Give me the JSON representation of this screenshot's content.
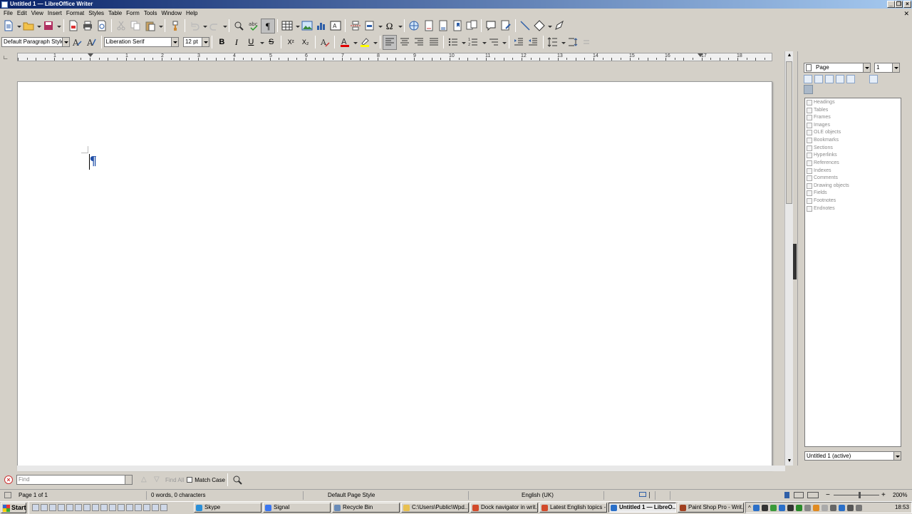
{
  "window": {
    "title": "Untitled 1 — LibreOffice Writer",
    "minimize": "_",
    "restore": "❐",
    "close": "×"
  },
  "menubar": {
    "items": [
      "File",
      "Edit",
      "View",
      "Insert",
      "Format",
      "Styles",
      "Table",
      "Form",
      "Tools",
      "Window",
      "Help"
    ],
    "doc_close": "✕"
  },
  "formatting": {
    "paragraph_style": "Default Paragraph Style",
    "font_name": "Liberation Serif",
    "font_size": "12 pt",
    "bold": "B",
    "italic": "I",
    "underline": "U",
    "strike": "S",
    "superscript": "X²",
    "subscript": "X₂"
  },
  "ruler": {
    "numbers": [
      "1",
      "1",
      "2",
      "3",
      "4",
      "5",
      "6",
      "7",
      "8",
      "9",
      "10",
      "11",
      "12",
      "13",
      "14",
      "15",
      "16",
      "17",
      "18"
    ]
  },
  "document": {
    "pilcrow": "¶"
  },
  "sidebar": {
    "navigate_by": "Page",
    "page_number": "1",
    "navigator_items": [
      "Headings",
      "Tables",
      "Frames",
      "Images",
      "OLE objects",
      "Bookmarks",
      "Sections",
      "Hyperlinks",
      "References",
      "Indexes",
      "Comments",
      "Drawing objects",
      "Fields",
      "Footnotes",
      "Endnotes"
    ],
    "document_select": "Untitled 1 (active)"
  },
  "findbar": {
    "placeholder": "Find",
    "find_all": "Find All",
    "match_case": "Match Case"
  },
  "statusbar": {
    "page": "Page 1 of 1",
    "words": "0 words, 0 characters",
    "page_style": "Default Page Style",
    "language": "English (UK)",
    "zoom": "200%",
    "zoom_minus": "−",
    "zoom_plus": "+"
  },
  "taskbar": {
    "start": "Start",
    "tasks": [
      {
        "label": "Skype",
        "color": "#2a8fd8"
      },
      {
        "label": "Signal",
        "color": "#3a76f0"
      },
      {
        "label": "Recycle Bin",
        "color": "#6a8cb8"
      },
      {
        "label": "C:\\Users\\Public\\Wpd...",
        "color": "#e8c050"
      },
      {
        "label": "Dock navigator in writ...",
        "color": "#d24a2a"
      },
      {
        "label": "Latest English topics -...",
        "color": "#d24a2a"
      },
      {
        "label": "Untitled 1 — LibreO...",
        "color": "#2a6fc8"
      },
      {
        "label": "Paint Shop Pro - Writ...",
        "color": "#a04020"
      }
    ],
    "clock": "18:53"
  },
  "colors": {
    "titlebar_start": "#0a246a",
    "titlebar_end": "#a6caf0",
    "font_color": "#e00000",
    "highlight": "#ffff00",
    "pilcrow": "#1f4ea8"
  }
}
